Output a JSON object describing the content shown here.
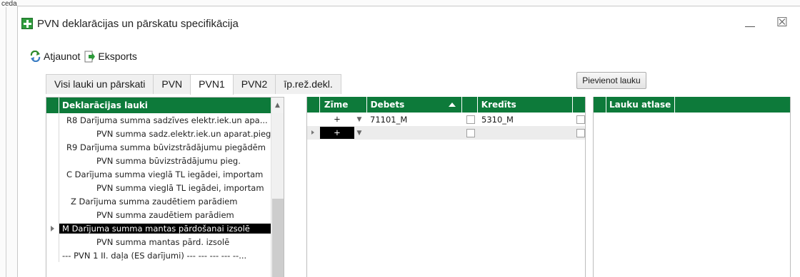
{
  "corner_fragment": "ceda",
  "window": {
    "title": "PVN deklarācijas un pārskatu specifikācija",
    "close_glyph": "☒"
  },
  "toolbar": {
    "refresh_label": "Atjaunot",
    "export_label": "Eksports"
  },
  "tabs": [
    {
      "label": "Visi lauki un pārskati",
      "active": false
    },
    {
      "label": "PVN",
      "active": false
    },
    {
      "label": "PVN1",
      "active": true
    },
    {
      "label": "PVN2",
      "active": false
    },
    {
      "label": "īp.rež.dekl.",
      "active": false
    }
  ],
  "add_field_button": "Pievienot lauku",
  "left_grid": {
    "header": "Deklarācijas lauki",
    "scroll_up_glyph": "▲",
    "rows": [
      {
        "text": "R8 Darījuma summa sadzīves elektr.iek.un apa...",
        "indent": 1,
        "selected": false
      },
      {
        "text": "PVN summa sadz.elektr.iek.un aparat.pieg...",
        "indent": 3,
        "selected": false
      },
      {
        "text": "R9 Darījuma summa būvizstrādājumu piegādēm",
        "indent": 1,
        "selected": false
      },
      {
        "text": "PVN summa būvizstrādājumu pieg.",
        "indent": 3,
        "selected": false
      },
      {
        "text": "C Darījuma summa vieglā TL iegādei, importam",
        "indent": 1,
        "selected": false
      },
      {
        "text": "PVN summa vieglā TL iegādei, importam",
        "indent": 3,
        "selected": false
      },
      {
        "text": "Z Darījuma summa zaudētiem parādiem",
        "indent": 2,
        "selected": false
      },
      {
        "text": "PVN summa zaudētiem parādiem",
        "indent": 3,
        "selected": false
      },
      {
        "text": "M Darījuma summa mantas pārdošanai izsolē",
        "indent": 0,
        "selected": true
      },
      {
        "text": "PVN summa mantas pārd. izsolē",
        "indent": 3,
        "selected": false
      },
      {
        "text": "--- PVN 1 II. daļa (ES darījumi) --- --- --- --- --...",
        "indent": 0,
        "selected": false
      }
    ]
  },
  "mid_grid": {
    "headers": {
      "zime": "Zīme",
      "debets": "Debets",
      "kredits": "Kredīts"
    },
    "rows": [
      {
        "zime": "+",
        "debets": "71101_M",
        "kredits": "5310_M",
        "current": false,
        "new": false
      },
      {
        "zime": "+",
        "debets": "",
        "kredits": "",
        "current": true,
        "new": true
      }
    ],
    "dropdown_glyph": "▼"
  },
  "right_grid": {
    "header": "Lauku atlase"
  }
}
